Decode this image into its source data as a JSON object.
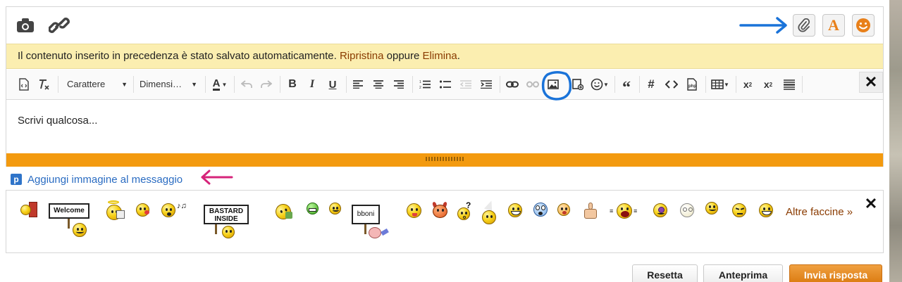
{
  "topbar": {
    "icons": [
      "camera-icon",
      "link-icon",
      "paperclip-icon",
      "font-color-icon",
      "smiley-icon"
    ],
    "font_button_letter": "A"
  },
  "autosave": {
    "message": "Il contenuto inserito in precedenza è stato salvato automaticamente.",
    "restore_label": "Ripristina",
    "or_text": "oppure",
    "delete_label": "Elimina",
    "end_punct": "."
  },
  "toolbar": {
    "font_select": "Carattere",
    "size_select": "Dimensi…",
    "text_color_letter": "A",
    "close_glyph": "✕"
  },
  "editor": {
    "placeholder": "Scrivi qualcosa..."
  },
  "add_image": {
    "badge": "p",
    "label": "Aggiungi immagine al messaggio"
  },
  "smileys": {
    "welcome_sign": "Welcome",
    "bastard_sign_line1": "BASTARD",
    "bastard_sign_line2": "INSIDE",
    "bboni_sign": "bboni",
    "more_label": "Altre faccine »",
    "close_glyph": "✕"
  },
  "footer": {
    "reset_label": "Resetta",
    "preview_label": "Anteprima",
    "submit_label": "Invia risposta"
  },
  "colors": {
    "accent_orange": "#f39a0f",
    "notice_bg": "#fbeeb0",
    "link_blue": "#2a6cc2",
    "annotation_blue": "#1a73d9",
    "annotation_pink": "#d6247a"
  }
}
